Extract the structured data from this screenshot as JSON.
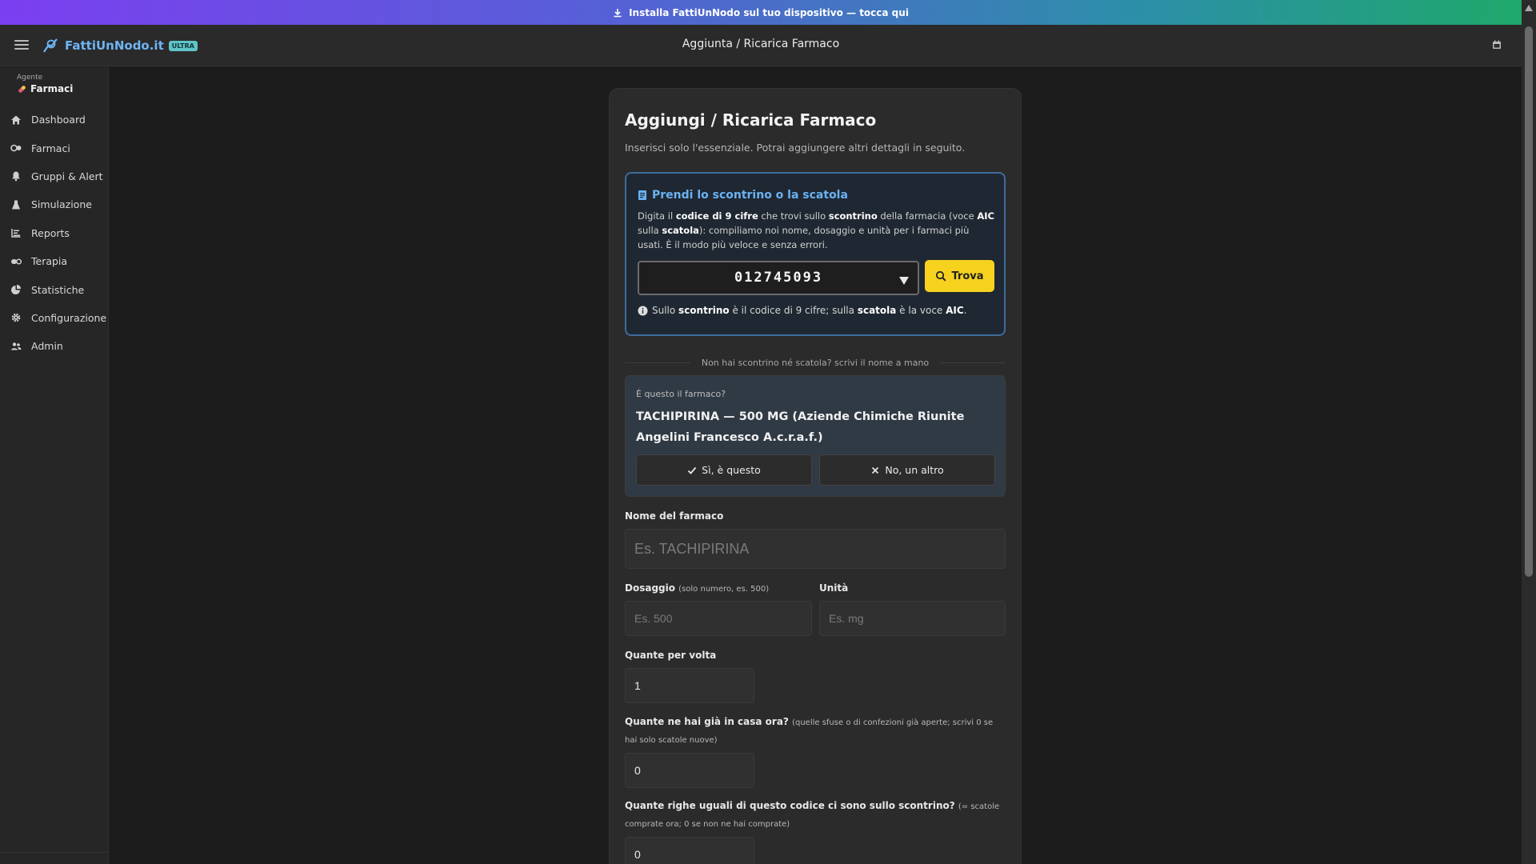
{
  "banner": {
    "text": "Installa FattiUnNodo sul tuo dispositivo — tocca qui"
  },
  "topbar": {
    "brand": "FattiUnNodo.it",
    "badge": "ULTRA",
    "title": "Aggiunta / Ricarica Farmaco"
  },
  "sidebar": {
    "agent_label": "Agente",
    "agent_value": "Farmaci",
    "items": [
      {
        "label": "Dashboard",
        "icon": "home-icon"
      },
      {
        "label": "Farmaci",
        "icon": "pills-icon"
      },
      {
        "label": "Gruppi & Alert",
        "icon": "bell-icon"
      },
      {
        "label": "Simulazione",
        "icon": "flask-icon"
      },
      {
        "label": "Reports",
        "icon": "list-icon"
      },
      {
        "label": "Terapia",
        "icon": "capsule-icon"
      },
      {
        "label": "Statistiche",
        "icon": "pie-chart-icon"
      },
      {
        "label": "Configurazione",
        "icon": "gear-icon"
      },
      {
        "label": "Admin",
        "icon": "users-icon"
      }
    ]
  },
  "form": {
    "title": "Aggiungi / Ricarica Farmaco",
    "subtitle": "Inserisci solo l'essenziale. Potrai aggiungere altri dettagli in seguito.",
    "scan": {
      "title": "Prendi lo scontrino o la scatola",
      "desc": {
        "t1": "Digita il ",
        "b1": "codice di 9 cifre",
        "t2": " che trovi sullo ",
        "b2": "scontrino",
        "t3": " della farmacia (voce ",
        "b3": "AIC",
        "t4": " sulla ",
        "b4": "scatola",
        "t5": "): compiliamo noi nome, dosaggio e unità per i farmaci più usati. È il modo più veloce e senza errori."
      },
      "code_value": "012745093",
      "find_label": "Trova",
      "hint": {
        "t1": "Sullo ",
        "b1": "scontrino",
        "t2": " è il codice di 9 cifre; sulla ",
        "b2": "scatola",
        "t3": " è la voce ",
        "b3": "AIC",
        "t4": "."
      }
    },
    "divider_text": "Non hai scontrino né scatola? scrivi il nome a mano",
    "confirm": {
      "question": "È questo il farmaco?",
      "name": "TACHIPIRINA — 500 MG (Aziende Chimiche Riunite Angelini Francesco A.c.r.a.f.)",
      "yes_label": "Sì, è questo",
      "no_label": "No, un altro"
    },
    "name_field": {
      "label": "Nome del farmaco",
      "placeholder": "Es. TACHIPIRINA"
    },
    "dose_field": {
      "label": "Dosaggio",
      "note": "(solo numero, es. 500)",
      "placeholder": "Es. 500"
    },
    "unit_field": {
      "label": "Unità",
      "placeholder": "Es. mg"
    },
    "per_time_field": {
      "label": "Quante per volta",
      "value": "1"
    },
    "home_field": {
      "label": "Quante ne hai già in casa ora?",
      "note": "(quelle sfuse o di confezioni già aperte; scrivi 0 se hai solo scatole nuove)",
      "value": "0"
    },
    "receipt_field": {
      "label": "Quante righe uguali di questo codice ci sono sullo scontrino?",
      "note": "(= scatole comprate ora; 0 se non ne hai comprate)",
      "value": "0"
    }
  },
  "colors": {
    "accent_blue": "#6ab2f3",
    "accent_yellow": "#f6d21f",
    "background": "#1c1c1c"
  }
}
